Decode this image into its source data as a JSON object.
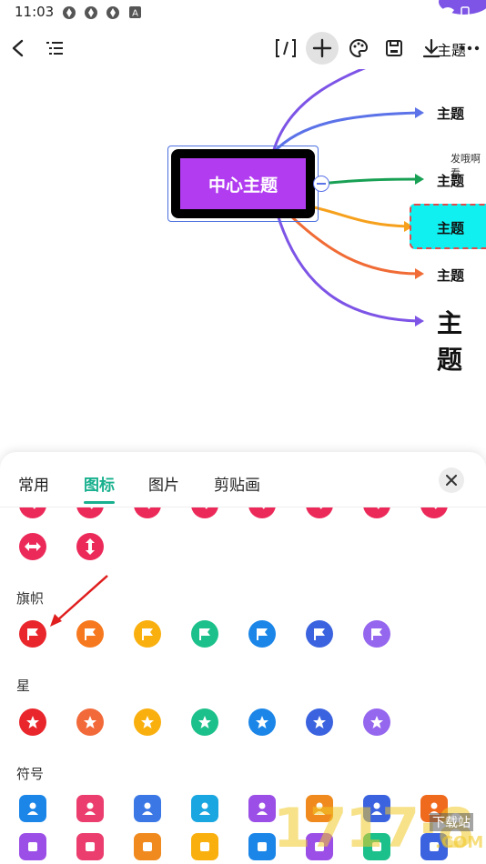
{
  "status_bar": {
    "time": "11:03"
  },
  "canvas": {
    "central_topic": "中心主题",
    "topics": [
      "主题",
      "主题",
      "主题",
      "主题",
      "主题",
      "主题"
    ],
    "note": "发哦啊看"
  },
  "panel": {
    "tabs": [
      {
        "label": "常用",
        "active": false
      },
      {
        "label": "图标",
        "active": true
      },
      {
        "label": "图片",
        "active": false
      },
      {
        "label": "剪贴画",
        "active": false
      }
    ],
    "sections": {
      "flag": "旗帜",
      "star": "星",
      "symbol": "符号"
    },
    "flag_colors": [
      "#e8262c",
      "#f7791f",
      "#f9b00f",
      "#1cc08a",
      "#1b86e8",
      "#3b63e0",
      "#9566ee"
    ],
    "star_colors": [
      "#e8262c",
      "#f26a3a",
      "#f9b00f",
      "#1cc08a",
      "#1b86e8",
      "#3b63e0",
      "#9566ee"
    ],
    "symbol_colors_row1": [
      "#1b86e8",
      "#ec3e6e",
      "#3b78e6",
      "#1aa6e0",
      "#9b4fe6",
      "#f08a1e",
      "#3b63e0",
      "#f06a1e"
    ],
    "symbol_colors_row2": [
      "#9b4fe6",
      "#ec3e6e",
      "#f08a1e",
      "#f9b00f",
      "#1b86e8",
      "#9b4fe6",
      "#1cc08a",
      "#3b63e0"
    ]
  },
  "watermark": {
    "text": "1717·8",
    "suffix": ".COM",
    "tag": "下载站"
  }
}
